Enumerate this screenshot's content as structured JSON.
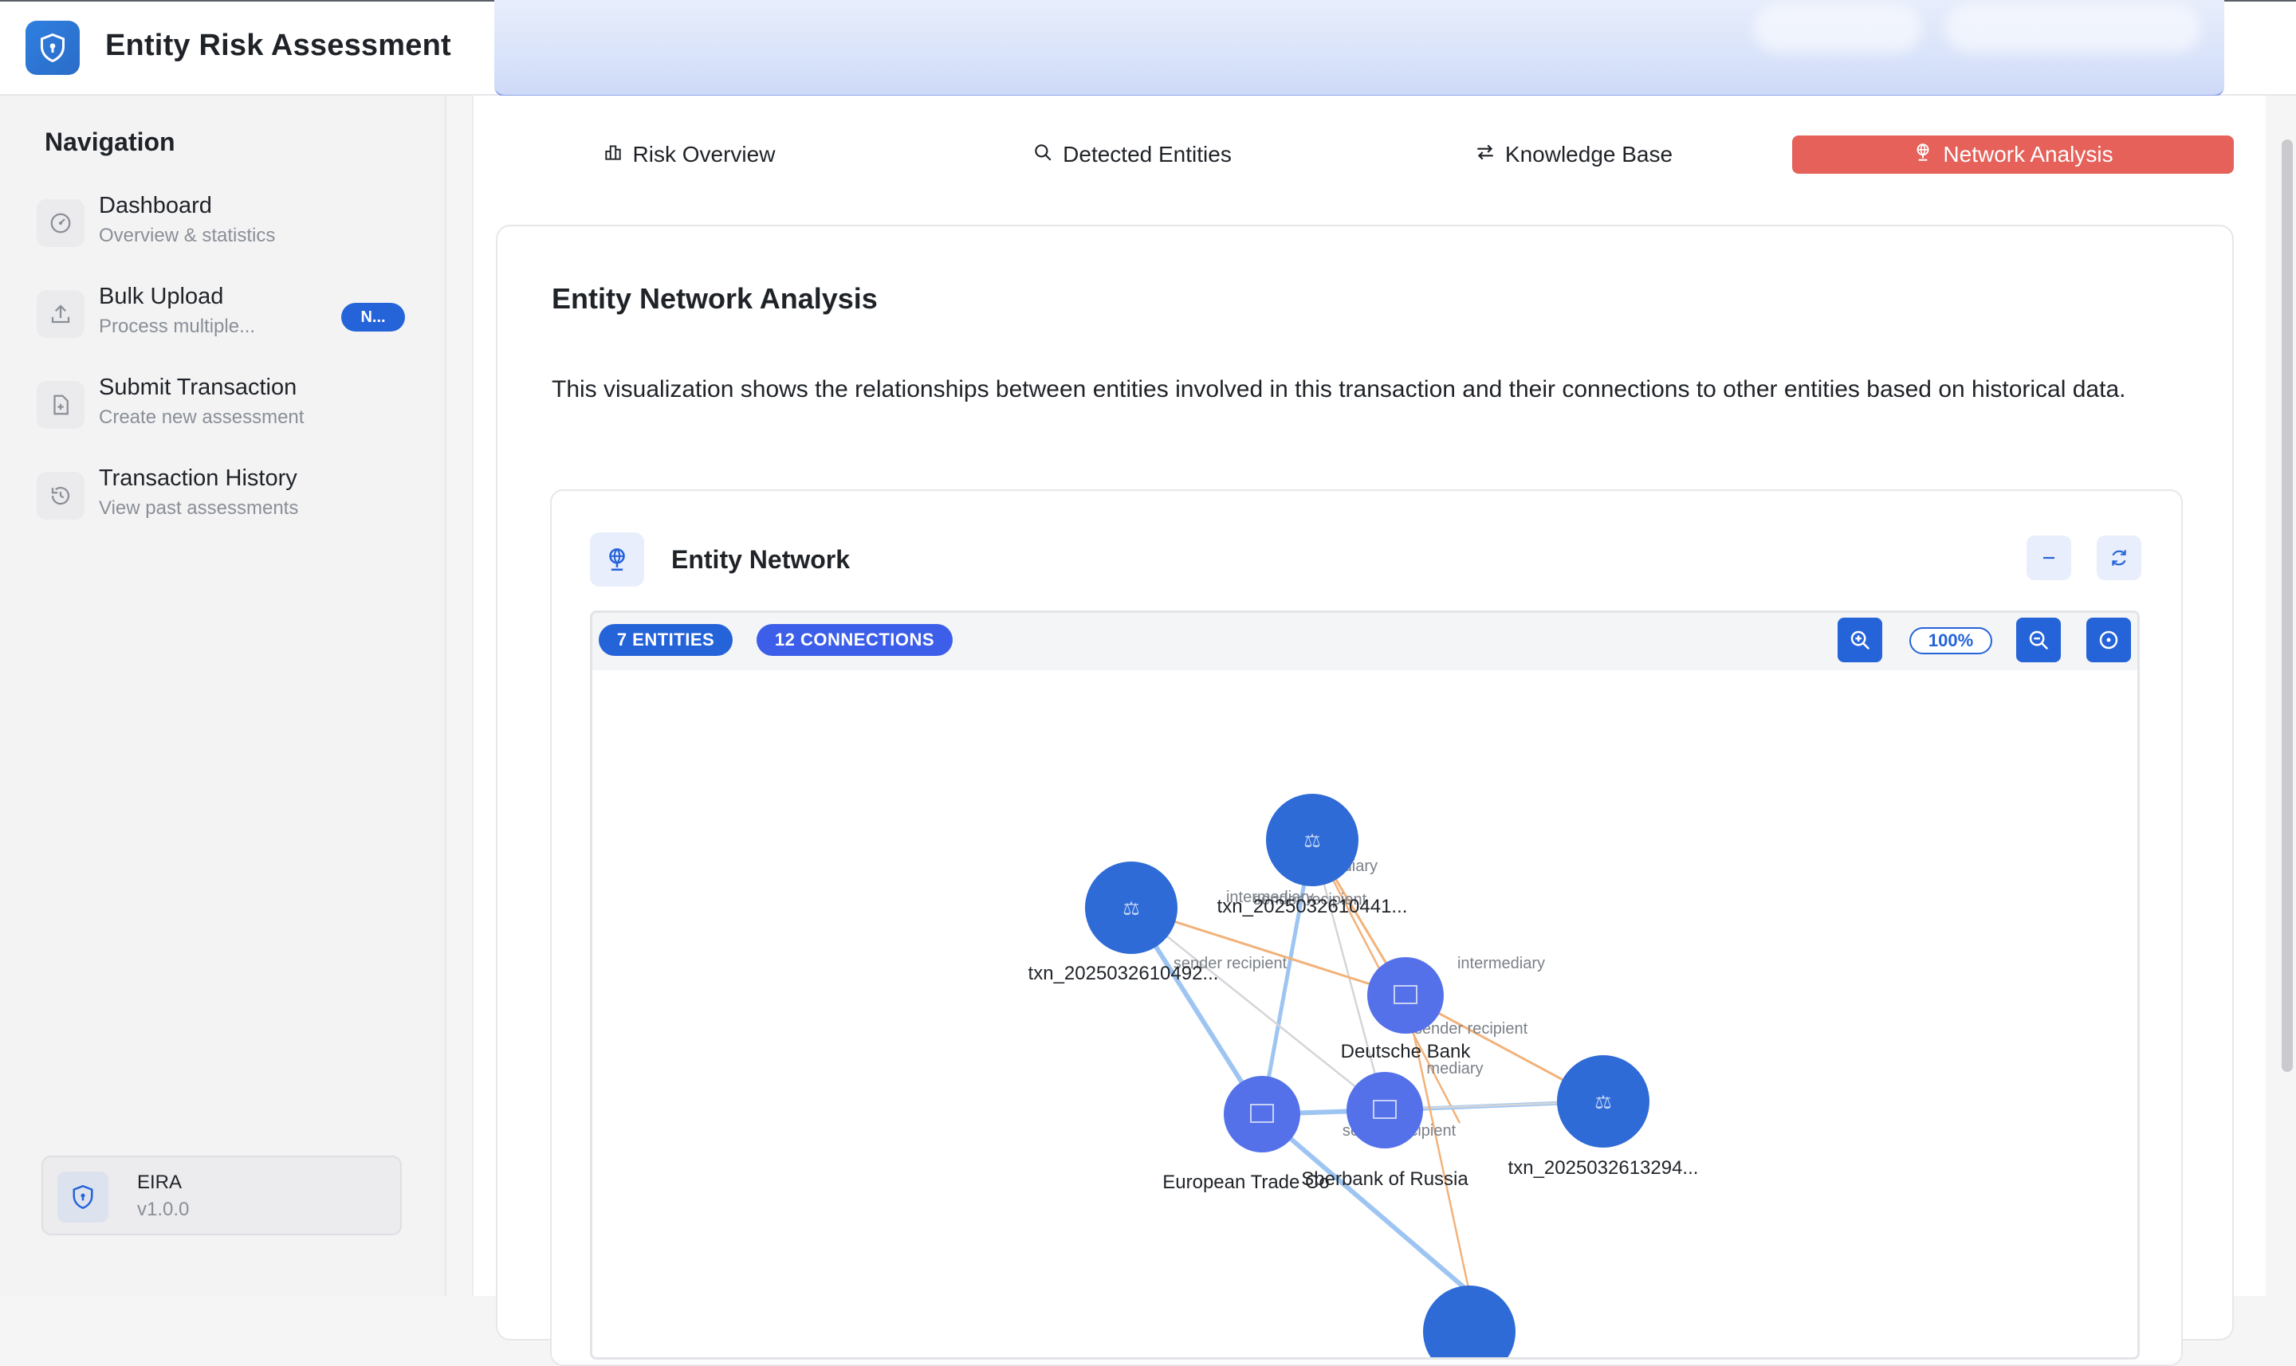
{
  "app": {
    "title": "Entity Risk Assessment"
  },
  "sidebar": {
    "heading": "Navigation",
    "items": [
      {
        "title": "Dashboard",
        "subtitle": "Overview & statistics",
        "icon": "gauge-icon"
      },
      {
        "title": "Bulk Upload",
        "subtitle": "Process multiple...",
        "icon": "upload-icon",
        "badge": "N..."
      },
      {
        "title": "Submit Transaction",
        "subtitle": "Create new assessment",
        "icon": "file-plus-icon"
      },
      {
        "title": "Transaction History",
        "subtitle": "View past assessments",
        "icon": "history-icon"
      }
    ],
    "footer": {
      "name": "EIRA",
      "version": "v1.0.0"
    }
  },
  "tabs": [
    {
      "label": "Risk Overview",
      "icon": "bar-chart-icon",
      "active": false
    },
    {
      "label": "Detected Entities",
      "icon": "search-icon",
      "active": false
    },
    {
      "label": "Knowledge Base",
      "icon": "arrows-swap-icon",
      "active": false
    },
    {
      "label": "Network Analysis",
      "icon": "network-icon",
      "active": true
    }
  ],
  "analysis": {
    "title": "Entity Network Analysis",
    "description": "This visualization shows the relationships between entities involved in this transaction and their connections to other entities based on historical data."
  },
  "network": {
    "title": "Entity Network",
    "entities_badge": "7 ENTITIES",
    "connections_badge": "12 CONNECTIONS",
    "zoom_level": "100%",
    "nodes": [
      {
        "id": "t1",
        "label": "txn_2025032610441...",
        "kind": "transaction"
      },
      {
        "id": "t2",
        "label": "txn_2025032610492...",
        "kind": "transaction"
      },
      {
        "id": "db",
        "label": "Deutsche Bank",
        "kind": "bank"
      },
      {
        "id": "t3",
        "label": "txn_2025032613294...",
        "kind": "transaction"
      },
      {
        "id": "et",
        "label": "European Trade Co",
        "kind": "bank"
      },
      {
        "id": "sr",
        "label": "Sberbank of Russia",
        "kind": "bank"
      },
      {
        "id": "t4",
        "label": "",
        "kind": "transaction"
      }
    ],
    "edge_labels": [
      "intermediary",
      "sender recipient",
      "intermediary",
      "sender recipient",
      "intermediary",
      "sender recipient",
      "mediary",
      "sender recipient",
      "intermediary"
    ],
    "colors": {
      "txn_node": "#2e6bd6",
      "bank_node": "#5571ea",
      "blue_edge": "#9ec5f2",
      "orange_edge": "#f2b27a",
      "gray_edge": "#d3d5d9",
      "active_tab": "#e5615a",
      "accent": "#2563d9"
    }
  }
}
